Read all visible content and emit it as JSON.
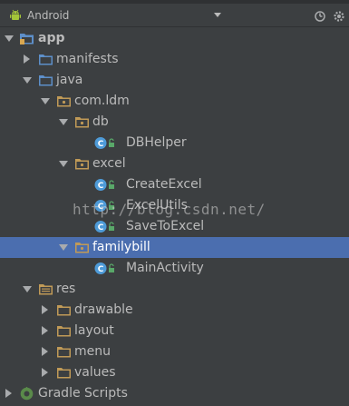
{
  "toolbar": {
    "view_label": "Android",
    "android_icon": "android-robot-icon",
    "sync_icon": "sync-icon",
    "gear_icon": "gear-icon"
  },
  "tree": {
    "app": "app",
    "manifests": "manifests",
    "java": "java",
    "com_ldm": "com.ldm",
    "db": "db",
    "db_helper": "DBHelper",
    "excel": "excel",
    "create_excel": "CreateExcel",
    "excel_utils": "ExcelUtils",
    "save_to_excel": "SaveToExcel",
    "familybill": "familybill",
    "main_activity": "MainActivity",
    "res": "res",
    "drawable": "drawable",
    "layout": "layout",
    "menu": "menu",
    "values": "values",
    "gradle_scripts": "Gradle Scripts"
  },
  "watermark": "http://blog.csdn.net/",
  "colors": {
    "background": "#3c3f41",
    "selection": "#4b6eaf",
    "folder_blue": "#5d8fc9",
    "folder_orange": "#c09a57",
    "class_badge": "#4e9bd8",
    "access_green": "#59a869"
  }
}
